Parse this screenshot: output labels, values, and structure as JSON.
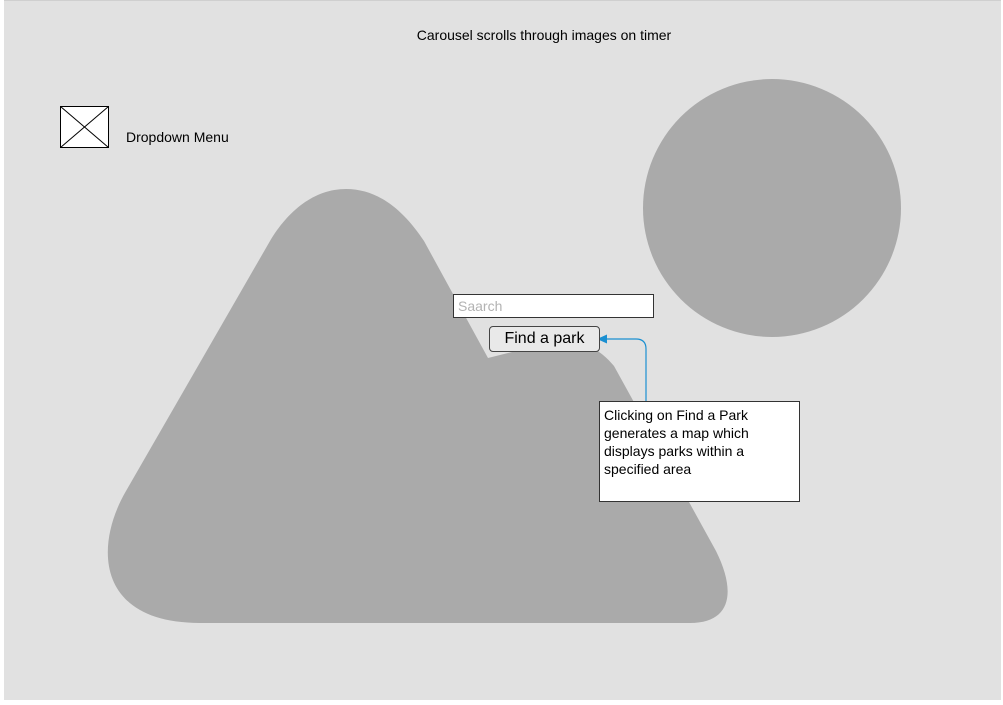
{
  "header": {
    "caption": "Carousel scrolls through images on timer"
  },
  "menu": {
    "label": "Dropdown Menu",
    "icon": "image-placeholder-icon"
  },
  "search": {
    "placeholder": "Saarch",
    "value": ""
  },
  "actions": {
    "find_label": "Find a park"
  },
  "annotation": {
    "text": "Clicking on Find a Park generates a map which displays parks within a specified area"
  },
  "colors": {
    "canvas": "#e1e1e1",
    "shape": "#aaaaaa",
    "connector": "#1a8fd1"
  }
}
